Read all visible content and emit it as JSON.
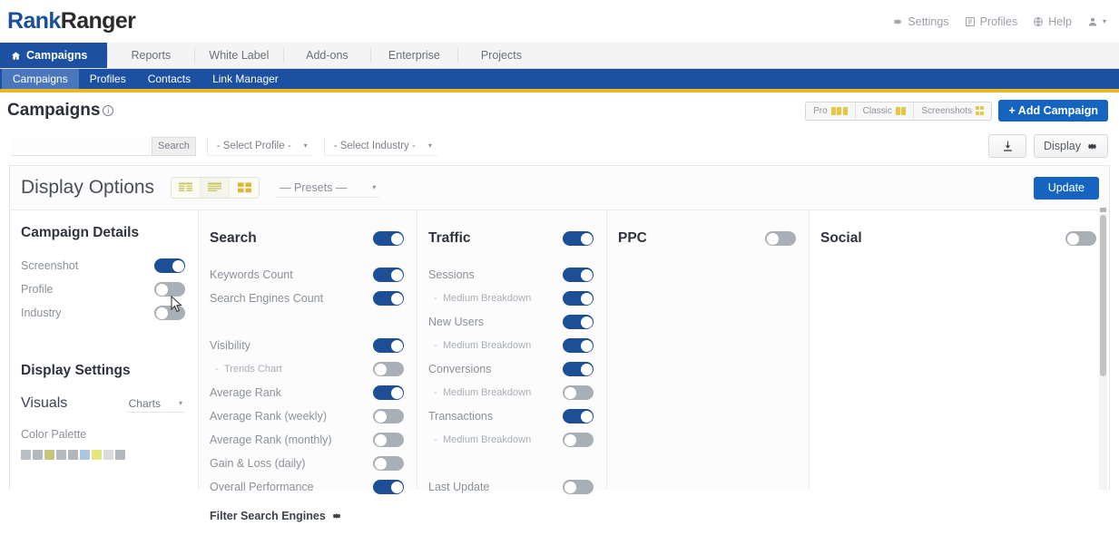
{
  "brand": {
    "name_part1": "Rank",
    "name_part2": "Ranger"
  },
  "header": {
    "utility": [
      {
        "label": "Settings",
        "icon": "gear-icon"
      },
      {
        "label": "Profiles",
        "icon": "profiles-book-icon"
      },
      {
        "label": "Help",
        "icon": "help-globe-icon"
      },
      {
        "label": "",
        "icon": "user-icon"
      }
    ]
  },
  "primary_tabs": [
    {
      "label": "Campaigns",
      "active": true,
      "icon": "home-icon"
    },
    {
      "label": "Reports",
      "active": false
    },
    {
      "label": "White Label",
      "active": false
    },
    {
      "label": "Add-ons",
      "active": false
    },
    {
      "label": "Enterprise",
      "active": false
    },
    {
      "label": "Projects",
      "active": false
    }
  ],
  "sub_nav": [
    {
      "label": "Campaigns",
      "active": true
    },
    {
      "label": "Profiles",
      "active": false
    },
    {
      "label": "Contacts",
      "active": false
    },
    {
      "label": "Link Manager",
      "active": false
    }
  ],
  "page": {
    "title": "Campaigns",
    "info_glyph": "i",
    "view_modes": [
      {
        "label": "Pro",
        "icon": "rows-icon"
      },
      {
        "label": "Classic",
        "icon": "list-icon"
      },
      {
        "label": "Screenshots",
        "icon": "grid-icon"
      }
    ],
    "add_campaign_label": "+ Add Campaign"
  },
  "filters": {
    "search_value": "",
    "search_placeholder": "",
    "search_button": "Search",
    "profile_select": "- Select Profile -",
    "industry_select": "- Select Industry -",
    "download_icon": "download-icon",
    "display_button": "Display",
    "display_icon": "gear-icon"
  },
  "display_options": {
    "title": "Display Options",
    "layout_icons": [
      {
        "name": "table-layout-icon",
        "selected": false
      },
      {
        "name": "list-layout-icon",
        "selected": true
      },
      {
        "name": "grid-layout-icon",
        "selected": false
      }
    ],
    "presets_label": "— Presets —",
    "update_label": "Update"
  },
  "columns": {
    "campaign_details": {
      "title": "Campaign Details",
      "items": [
        {
          "label": "Screenshot",
          "on": true,
          "sub": false
        },
        {
          "label": "Profile",
          "on": false,
          "sub": false
        },
        {
          "label": "Industry",
          "on": false,
          "sub": false
        }
      ]
    },
    "display_settings": {
      "title": "Display Settings",
      "visuals_label": "Visuals",
      "visuals_value": "Charts",
      "color_palette_label": "Color Palette",
      "palette_colors": [
        "#b9bfc4",
        "#b2b8bd",
        "#c3c77e",
        "#b4bac0",
        "#b0b6bc",
        "#a9c8e0",
        "#e3e87a",
        "#dcdcdc",
        "#b3b9bf"
      ]
    },
    "search": {
      "title": "Search",
      "master_on": true,
      "items": [
        {
          "label": "Keywords Count",
          "on": true,
          "sub": false
        },
        {
          "label": "Search Engines Count",
          "on": true,
          "sub": false
        },
        {
          "label": "__SPACER__",
          "on": false,
          "sub": false
        },
        {
          "label": "Visibility",
          "on": true,
          "sub": false
        },
        {
          "label": "Trends Chart",
          "on": false,
          "sub": true
        },
        {
          "label": "Average Rank",
          "on": true,
          "sub": false
        },
        {
          "label": "Average Rank (weekly)",
          "on": false,
          "sub": false
        },
        {
          "label": "Average Rank (monthly)",
          "on": false,
          "sub": false
        },
        {
          "label": "Gain & Loss (daily)",
          "on": false,
          "sub": false
        },
        {
          "label": "Overall Performance",
          "on": true,
          "sub": false
        }
      ],
      "filter_label": "Filter Search Engines",
      "filter_icon": "gear-icon"
    },
    "traffic": {
      "title": "Traffic",
      "master_on": true,
      "items": [
        {
          "label": "Sessions",
          "on": true,
          "sub": false
        },
        {
          "label": "Medium Breakdown",
          "on": true,
          "sub": true
        },
        {
          "label": "New Users",
          "on": true,
          "sub": false
        },
        {
          "label": "Medium Breakdown",
          "on": true,
          "sub": true
        },
        {
          "label": "Conversions",
          "on": true,
          "sub": false
        },
        {
          "label": "Medium Breakdown",
          "on": false,
          "sub": true
        },
        {
          "label": "Transactions",
          "on": true,
          "sub": false
        },
        {
          "label": "Medium Breakdown",
          "on": false,
          "sub": true
        },
        {
          "label": "__SPACER__",
          "on": false,
          "sub": false
        },
        {
          "label": "Last Update",
          "on": false,
          "sub": false
        }
      ]
    },
    "ppc": {
      "title": "PPC",
      "master_on": false,
      "items": []
    },
    "social": {
      "title": "Social",
      "master_on": false,
      "items": []
    }
  }
}
